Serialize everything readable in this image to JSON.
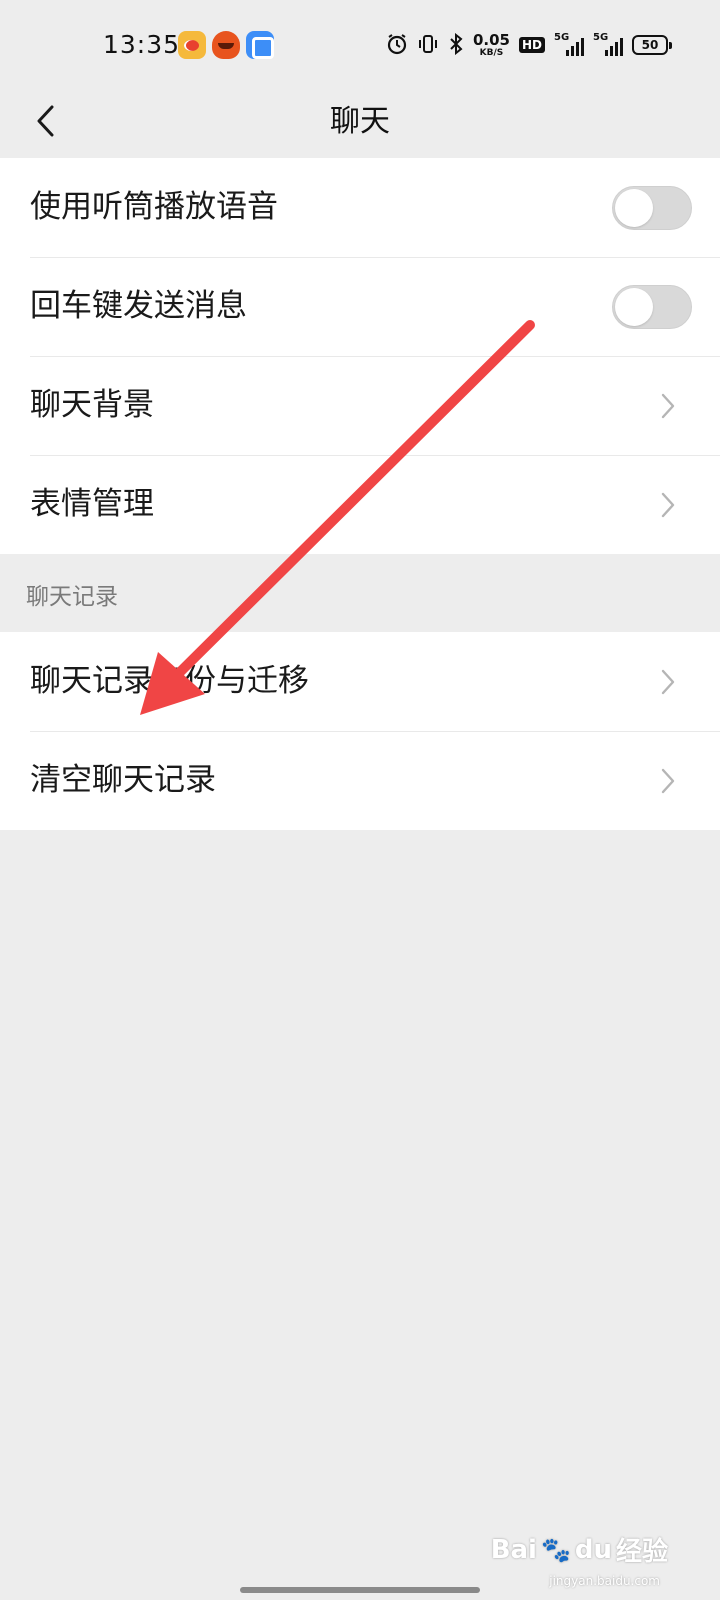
{
  "status_bar": {
    "time": "13:35",
    "app_icons": [
      "weibo-icon",
      "taobao-icon",
      "app-icon"
    ],
    "alarm_icon": "alarm-icon",
    "vibrate_icon": "vibrate-icon",
    "bluetooth_icon": "bluetooth-icon",
    "net_speed_value": "0.05",
    "net_speed_unit": "KB/S",
    "hd_badge": "HD",
    "signal_1": "5G",
    "signal_2": "5G",
    "battery": "50"
  },
  "nav": {
    "back_icon": "chevron-left-icon",
    "title": "聊天"
  },
  "settings_group_1": [
    {
      "label": "使用听筒播放语音",
      "control": "toggle",
      "value": false
    },
    {
      "label": "回车键发送消息",
      "control": "toggle",
      "value": false
    },
    {
      "label": "聊天背景",
      "control": "chevron"
    },
    {
      "label": "表情管理",
      "control": "chevron"
    }
  ],
  "section_header": "聊天记录",
  "settings_group_2": [
    {
      "label": "聊天记录备份与迁移",
      "control": "chevron"
    },
    {
      "label": "清空聊天记录",
      "control": "chevron"
    }
  ],
  "annotation": {
    "color": "#f04545",
    "type": "arrow"
  },
  "watermark": {
    "brand": "Bai",
    "brand_suffix": "du",
    "cn": "经验",
    "sub": "jingyan.baidu.com"
  },
  "colors": {
    "background": "#ededed",
    "card": "#ffffff",
    "toggle_off": "#d9d9d9",
    "chevron": "#b5b5b5"
  }
}
